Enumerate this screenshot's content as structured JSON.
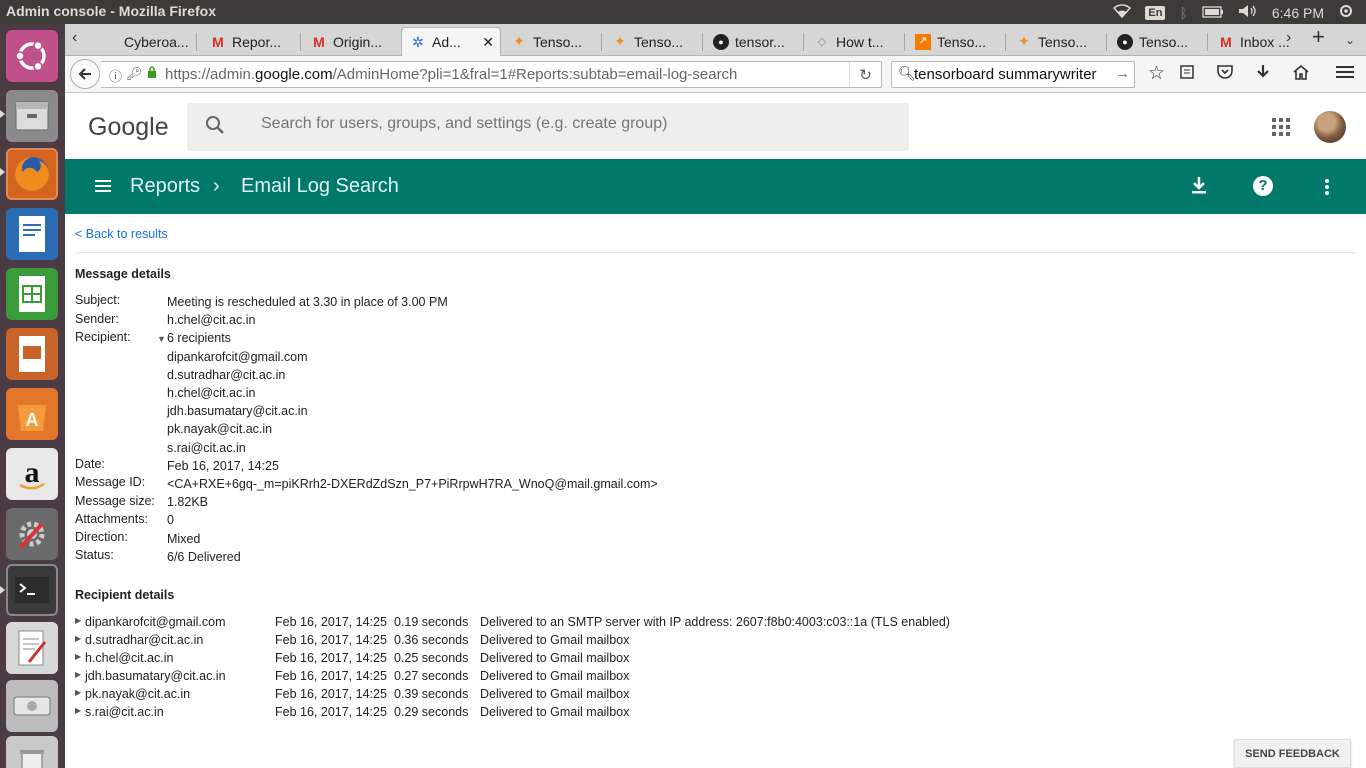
{
  "system": {
    "window_title": "Admin console - Mozilla Firefox",
    "keyboard_layout": "En",
    "clock": "6:46 PM"
  },
  "launcher": {
    "icons": [
      "ubuntu-dash-icon",
      "files-icon",
      "firefox-icon",
      "writer-icon",
      "calc-icon",
      "impress-icon",
      "software-center-icon",
      "amazon-icon",
      "system-settings-icon",
      "terminal-icon",
      "text-editor-icon",
      "disk-icon",
      "trash-icon"
    ]
  },
  "tabs": [
    {
      "label": "Cyberoa...",
      "icon": "cyberoam-icon"
    },
    {
      "label": "Repor...",
      "icon": "gmail-icon"
    },
    {
      "label": "Origin...",
      "icon": "gmail-icon"
    },
    {
      "label": "Ad...",
      "icon": "admin-icon",
      "active": true
    },
    {
      "label": "Tenso...",
      "icon": "tensorflow-icon"
    },
    {
      "label": "Tenso...",
      "icon": "tensorflow-icon"
    },
    {
      "label": "tensor...",
      "icon": "github-icon"
    },
    {
      "label": "How t...",
      "icon": "generic-page-icon"
    },
    {
      "label": "Tenso...",
      "icon": "tensorboard-icon"
    },
    {
      "label": "Tenso...",
      "icon": "tensorflow-icon"
    },
    {
      "label": "Tenso...",
      "icon": "github-icon"
    },
    {
      "label": "Inbox ...",
      "icon": "gmail-icon"
    }
  ],
  "navbar": {
    "url_prefix": "https://admin.",
    "url_domain": "google.com",
    "url_path": "/AdminHome?pli=1&fral=1#Reports:subtab=email-log-search",
    "search_value": "tensorboard summarywriter"
  },
  "google": {
    "logo_text": "Google",
    "search_placeholder": "Search for users, groups, and settings (e.g. create group)"
  },
  "toolbar": {
    "crumb_reports": "Reports",
    "crumb_separator": "›",
    "crumb_current": "Email Log Search",
    "help_glyph": "?"
  },
  "content": {
    "back_link": "< Back to results",
    "message_details_title": "Message details",
    "labels": {
      "subject": "Subject:",
      "sender": "Sender:",
      "recipient": "Recipient:",
      "date": "Date:",
      "message_id": "Message ID:",
      "message_size": "Message size:",
      "attachments": "Attachments:",
      "direction": "Direction:",
      "status": "Status:"
    },
    "values": {
      "subject": "Meeting is rescheduled at 3.30 in place of 3.00 PM",
      "sender": "h.chel@cit.ac.in",
      "recipient_count": "6 recipients",
      "recipients": [
        "dipankarofcit@gmail.com",
        "d.sutradhar@cit.ac.in",
        "h.chel@cit.ac.in",
        "jdh.basumatary@cit.ac.in",
        "pk.nayak@cit.ac.in",
        "s.rai@cit.ac.in"
      ],
      "date": "Feb 16, 2017, 14:25",
      "message_id": "<CA+RXE+6gq-_m=piKRrh2-DXERdZdSzn_P7+PiRrpwH7RA_WnoQ@mail.gmail.com>",
      "message_size": "1.82KB",
      "attachments": "0",
      "direction": "Mixed",
      "status": "6/6 Delivered"
    },
    "recipient_details_title": "Recipient details",
    "recipient_details": [
      {
        "email": "dipankarofcit@gmail.com",
        "date": "Feb 16, 2017, 14:25",
        "duration": "0.19 seconds",
        "result": "Delivered to an SMTP server with IP address: 2607:f8b0:4003:c03::1a (TLS enabled)"
      },
      {
        "email": "d.sutradhar@cit.ac.in",
        "date": "Feb 16, 2017, 14:25",
        "duration": "0.36 seconds",
        "result": "Delivered to Gmail mailbox"
      },
      {
        "email": "h.chel@cit.ac.in",
        "date": "Feb 16, 2017, 14:25",
        "duration": "0.25 seconds",
        "result": "Delivered to Gmail mailbox"
      },
      {
        "email": "jdh.basumatary@cit.ac.in",
        "date": "Feb 16, 2017, 14:25",
        "duration": "0.27 seconds",
        "result": "Delivered to Gmail mailbox"
      },
      {
        "email": "pk.nayak@cit.ac.in",
        "date": "Feb 16, 2017, 14:25",
        "duration": "0.39 seconds",
        "result": "Delivered to Gmail mailbox"
      },
      {
        "email": "s.rai@cit.ac.in",
        "date": "Feb 16, 2017, 14:25",
        "duration": "0.29 seconds",
        "result": "Delivered to Gmail mailbox"
      }
    ],
    "send_feedback": "SEND FEEDBACK"
  },
  "colors": {
    "teal": "#00796b",
    "link": "#1a73e8",
    "launcher_bg": "#4a3b44",
    "panel_bg": "#3c3b37"
  }
}
